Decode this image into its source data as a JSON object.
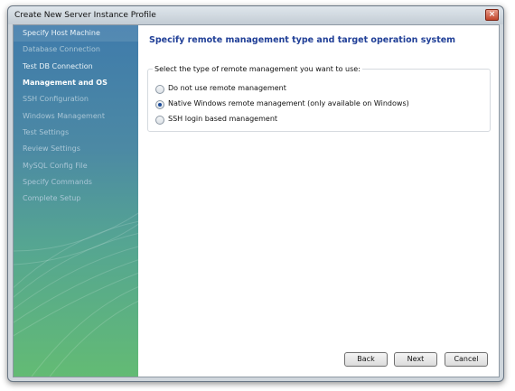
{
  "window": {
    "title": "Create New Server Instance Profile",
    "close_glyph": "×"
  },
  "sidebar": {
    "steps": [
      {
        "label": "Specify Host Machine",
        "state": "done"
      },
      {
        "label": "Database Connection",
        "state": "pending"
      },
      {
        "label": "Test DB Connection",
        "state": "done"
      },
      {
        "label": "Management and OS",
        "state": "current"
      },
      {
        "label": "SSH Configuration",
        "state": "pending"
      },
      {
        "label": "Windows Management",
        "state": "pending"
      },
      {
        "label": "Test Settings",
        "state": "pending"
      },
      {
        "label": "Review Settings",
        "state": "pending"
      },
      {
        "label": "MySQL Config File",
        "state": "pending"
      },
      {
        "label": "Specify Commands",
        "state": "pending"
      },
      {
        "label": "Complete Setup",
        "state": "pending"
      }
    ]
  },
  "main": {
    "heading": "Specify remote management type and target operation system",
    "group_label": "Select the type of remote management you want to use:",
    "options": [
      {
        "label": "Do not use remote management",
        "checked": false
      },
      {
        "label": "Native Windows remote management (only available on Windows)",
        "checked": true
      },
      {
        "label": "SSH login based management",
        "checked": false
      }
    ]
  },
  "buttons": {
    "back": "Back",
    "next": "Next",
    "cancel": "Cancel"
  },
  "colors": {
    "heading": "#203f97",
    "sidebar_top": "#3f7bab",
    "sidebar_bottom": "#63bb74"
  }
}
